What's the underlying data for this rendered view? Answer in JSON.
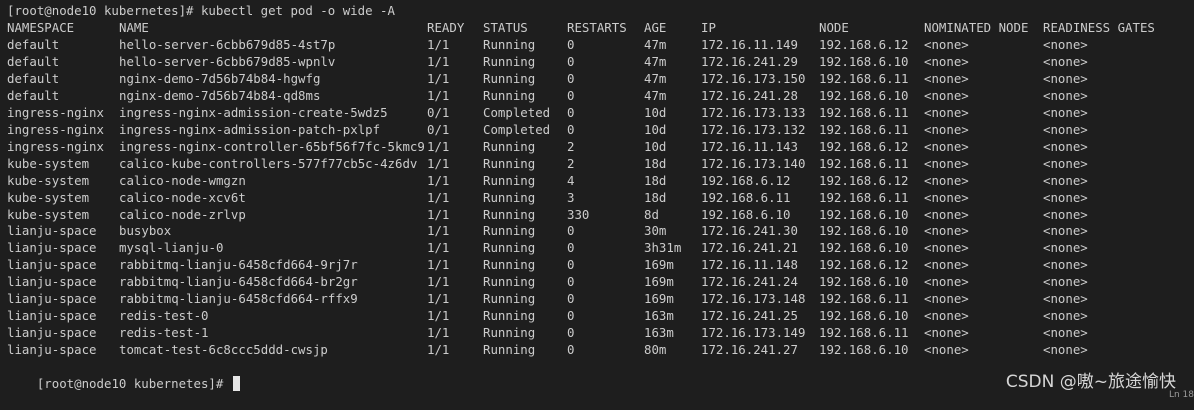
{
  "terminal": {
    "command_line": "[root@node10 kubernetes]# kubectl get pod -o wide -A",
    "prompt": "[root@node10 kubernetes]# ",
    "headers": [
      "NAMESPACE",
      "NAME",
      "READY",
      "STATUS",
      "RESTARTS",
      "AGE",
      "IP",
      "NODE",
      "NOMINATED NODE",
      "READINESS GATES"
    ],
    "rows": [
      [
        "default",
        "hello-server-6cbb679d85-4st7p",
        "1/1",
        "Running",
        "0",
        "47m",
        "172.16.11.149",
        "192.168.6.12",
        "<none>",
        "<none>"
      ],
      [
        "default",
        "hello-server-6cbb679d85-wpnlv",
        "1/1",
        "Running",
        "0",
        "47m",
        "172.16.241.29",
        "192.168.6.10",
        "<none>",
        "<none>"
      ],
      [
        "default",
        "nginx-demo-7d56b74b84-hgwfg",
        "1/1",
        "Running",
        "0",
        "47m",
        "172.16.173.150",
        "192.168.6.11",
        "<none>",
        "<none>"
      ],
      [
        "default",
        "nginx-demo-7d56b74b84-qd8ms",
        "1/1",
        "Running",
        "0",
        "47m",
        "172.16.241.28",
        "192.168.6.10",
        "<none>",
        "<none>"
      ],
      [
        "ingress-nginx",
        "ingress-nginx-admission-create-5wdz5",
        "0/1",
        "Completed",
        "0",
        "10d",
        "172.16.173.133",
        "192.168.6.11",
        "<none>",
        "<none>"
      ],
      [
        "ingress-nginx",
        "ingress-nginx-admission-patch-pxlpf",
        "0/1",
        "Completed",
        "0",
        "10d",
        "172.16.173.132",
        "192.168.6.11",
        "<none>",
        "<none>"
      ],
      [
        "ingress-nginx",
        "ingress-nginx-controller-65bf56f7fc-5kmc9",
        "1/1",
        "Running",
        "2",
        "10d",
        "172.16.11.143",
        "192.168.6.12",
        "<none>",
        "<none>"
      ],
      [
        "kube-system",
        "calico-kube-controllers-577f77cb5c-4z6dv",
        "1/1",
        "Running",
        "2",
        "18d",
        "172.16.173.140",
        "192.168.6.11",
        "<none>",
        "<none>"
      ],
      [
        "kube-system",
        "calico-node-wmgzn",
        "1/1",
        "Running",
        "4",
        "18d",
        "192.168.6.12",
        "192.168.6.12",
        "<none>",
        "<none>"
      ],
      [
        "kube-system",
        "calico-node-xcv6t",
        "1/1",
        "Running",
        "3",
        "18d",
        "192.168.6.11",
        "192.168.6.11",
        "<none>",
        "<none>"
      ],
      [
        "kube-system",
        "calico-node-zrlvp",
        "1/1",
        "Running",
        "330",
        "8d",
        "192.168.6.10",
        "192.168.6.10",
        "<none>",
        "<none>"
      ],
      [
        "lianju-space",
        "busybox",
        "1/1",
        "Running",
        "0",
        "30m",
        "172.16.241.30",
        "192.168.6.10",
        "<none>",
        "<none>"
      ],
      [
        "lianju-space",
        "mysql-lianju-0",
        "1/1",
        "Running",
        "0",
        "3h31m",
        "172.16.241.21",
        "192.168.6.10",
        "<none>",
        "<none>"
      ],
      [
        "lianju-space",
        "rabbitmq-lianju-6458cfd664-9rj7r",
        "1/1",
        "Running",
        "0",
        "169m",
        "172.16.11.148",
        "192.168.6.12",
        "<none>",
        "<none>"
      ],
      [
        "lianju-space",
        "rabbitmq-lianju-6458cfd664-br2gr",
        "1/1",
        "Running",
        "0",
        "169m",
        "172.16.241.24",
        "192.168.6.10",
        "<none>",
        "<none>"
      ],
      [
        "lianju-space",
        "rabbitmq-lianju-6458cfd664-rffx9",
        "1/1",
        "Running",
        "0",
        "169m",
        "172.16.173.148",
        "192.168.6.11",
        "<none>",
        "<none>"
      ],
      [
        "lianju-space",
        "redis-test-0",
        "1/1",
        "Running",
        "0",
        "163m",
        "172.16.241.25",
        "192.168.6.10",
        "<none>",
        "<none>"
      ],
      [
        "lianju-space",
        "redis-test-1",
        "1/1",
        "Running",
        "0",
        "163m",
        "172.16.173.149",
        "192.168.6.11",
        "<none>",
        "<none>"
      ],
      [
        "lianju-space",
        "tomcat-test-6c8ccc5ddd-cwsjp",
        "1/1",
        "Running",
        "0",
        "80m",
        "172.16.241.27",
        "192.168.6.10",
        "<none>",
        "<none>"
      ]
    ]
  },
  "watermark": "CSDN @嗷~旅途愉快",
  "status_corner": "Ln 18"
}
